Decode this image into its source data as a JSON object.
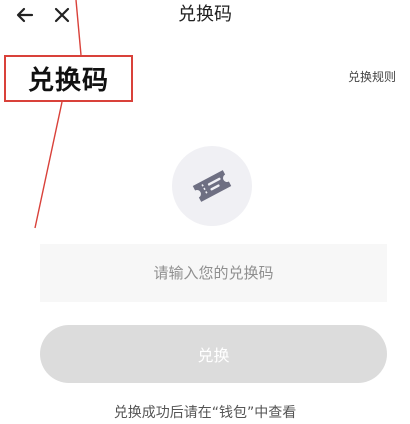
{
  "header": {
    "title": "兑换码",
    "back_icon": "arrow-left-icon",
    "close_icon": "close-icon"
  },
  "annotation": {
    "callout_text": "兑换码",
    "color": "#d9413a"
  },
  "rules_link": "兑换规则",
  "ticket_icon": "ticket-icon",
  "input": {
    "value": "",
    "placeholder": "请输入您的兑换码"
  },
  "redeem_button": {
    "label": "兑换",
    "background": "#dcdcdc"
  },
  "footer_hint": "兑换成功后请在“钱包”中查看"
}
